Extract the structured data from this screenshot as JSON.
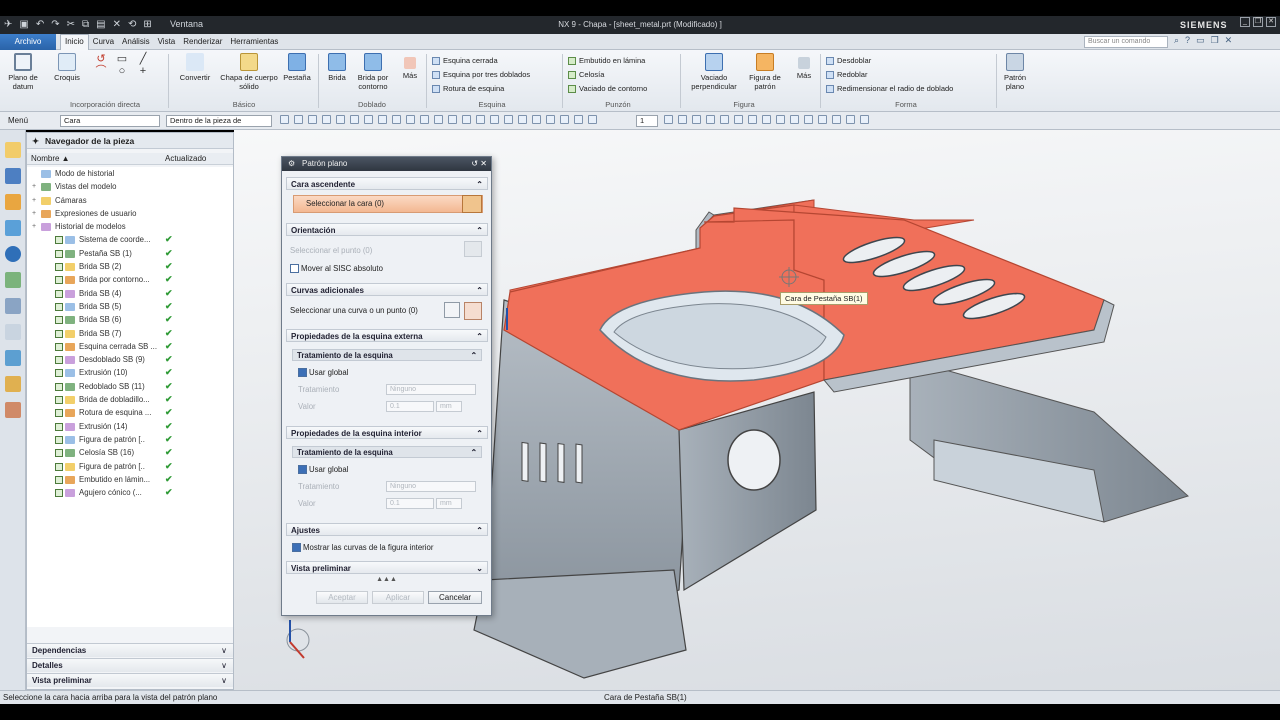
{
  "titlebar": {
    "ventana_label": "Ventana",
    "window_title": "NX 9 - Chapa - [sheet_metal.prt (Modificado) ]",
    "brand": "SIEMENS"
  },
  "menubar": {
    "archivo": "Archivo",
    "tabs": [
      "Inicio",
      "Curva",
      "Análisis",
      "Vista",
      "Renderizar",
      "Herramientas"
    ],
    "active_tab": "Inicio",
    "search_placeholder": "Buscar un comando"
  },
  "ribbon": {
    "plano_datum": "Plano de datum",
    "croquis": "Croquis",
    "convertir": "Convertir",
    "chapa_solido": "Chapa de cuerpo sólido",
    "pestana": "Pestaña",
    "brida": "Brida",
    "brida_contorno": "Brida por contorno",
    "mas1": "Más",
    "esquina_items": [
      "Esquina cerrada",
      "Esquina por tres doblados",
      "Rotura de esquina"
    ],
    "punzon_items": [
      "Embutido en lámina",
      "Celosía",
      "Vaciado de contorno"
    ],
    "vaciado_perp": "Vaciado perpendicular",
    "figura_patron": "Figura de patrón",
    "mas2": "Más",
    "forma_items": [
      "Desdoblar",
      "Redoblar",
      "Redimensionar el radio de doblado"
    ],
    "patron_plano": "Patrón plano",
    "groups": [
      "Incorporación directa",
      "Básico",
      "Doblado",
      "Esquina",
      "Punzón",
      "Figura",
      "Forma"
    ]
  },
  "toolbar2": {
    "menu_label": "Menú",
    "filter_value": "Cara",
    "scope_value": "Dentro de la pieza de",
    "count_value": "1"
  },
  "navigator": {
    "title": "Navegador de la pieza",
    "col_name": "Nombre",
    "col_updated": "Actualizado",
    "items": [
      {
        "label": "Modo de historial",
        "indent": 0,
        "ok": false
      },
      {
        "label": "Vistas del modelo",
        "indent": 0,
        "ok": false
      },
      {
        "label": "Cámaras",
        "indent": 0,
        "ok": false
      },
      {
        "label": "Expresiones de usuario",
        "indent": 0,
        "ok": false
      },
      {
        "label": "Historial de modelos",
        "indent": 0,
        "ok": false
      },
      {
        "label": "Sistema de coorde...",
        "indent": 1,
        "ok": true
      },
      {
        "label": "Pestaña SB (1)",
        "indent": 1,
        "ok": true
      },
      {
        "label": "Brida SB (2)",
        "indent": 1,
        "ok": true
      },
      {
        "label": "Brida por contorno...",
        "indent": 1,
        "ok": true
      },
      {
        "label": "Brida SB (4)",
        "indent": 1,
        "ok": true
      },
      {
        "label": "Brida SB (5)",
        "indent": 1,
        "ok": true
      },
      {
        "label": "Brida SB (6)",
        "indent": 1,
        "ok": true
      },
      {
        "label": "Brida SB (7)",
        "indent": 1,
        "ok": true
      },
      {
        "label": "Esquina cerrada SB ...",
        "indent": 1,
        "ok": true
      },
      {
        "label": "Desdoblado SB (9)",
        "indent": 1,
        "ok": true
      },
      {
        "label": "Extrusión (10)",
        "indent": 1,
        "ok": true
      },
      {
        "label": "Redoblado SB (11)",
        "indent": 1,
        "ok": true
      },
      {
        "label": "Brida de dobladillo...",
        "indent": 1,
        "ok": true
      },
      {
        "label": "Rotura de esquina ...",
        "indent": 1,
        "ok": true
      },
      {
        "label": "Extrusión (14)",
        "indent": 1,
        "ok": true
      },
      {
        "label": "Figura de patrón [..",
        "indent": 1,
        "ok": true
      },
      {
        "label": "Celosía SB (16)",
        "indent": 1,
        "ok": true
      },
      {
        "label": "Figura de patrón [..",
        "indent": 1,
        "ok": true
      },
      {
        "label": "Embutido en lámin...",
        "indent": 1,
        "ok": true
      },
      {
        "label": "Agujero cónico (...",
        "indent": 1,
        "ok": true
      }
    ],
    "accordions": [
      "Dependencias",
      "Detalles",
      "Vista preliminar"
    ]
  },
  "dialog": {
    "title": "Patrón plano",
    "sec_cara": "Cara ascendente",
    "sel_cara": "Seleccionar la cara (0)",
    "sec_orient": "Orientación",
    "sel_punto": "Seleccionar el punto (0)",
    "mover_sisc": "Mover al SISC absoluto",
    "sec_curvas": "Curvas adicionales",
    "sel_curva": "Seleccionar una curva o un punto (0)",
    "sec_ext": "Propiedades de la esquina externa",
    "tratamiento": "Tratamiento de la esquina",
    "usar_global": "Usar global",
    "tratamiento_lbl": "Tratamiento",
    "ninguno": "Ninguno",
    "valor_lbl": "Valor",
    "valor": "0.1",
    "unit": "mm",
    "sec_int": "Propiedades de la esquina interior",
    "sec_ajustes": "Ajustes",
    "mostrar_curvas": "Mostrar las curvas de la figura interior",
    "sec_vista": "Vista preliminar",
    "aceptar": "Aceptar",
    "aplicar": "Aplicar",
    "cancelar": "Cancelar"
  },
  "viewport": {
    "tooltip": "Cara de Pestaña SB(1)",
    "face_color": "#f0705a",
    "body_color": "#9aa4ad"
  },
  "statusbar": {
    "message": "Seleccione la cara hacia arriba para la vista del patrón plano",
    "selection": "Cara de Pestaña SB(1)"
  }
}
